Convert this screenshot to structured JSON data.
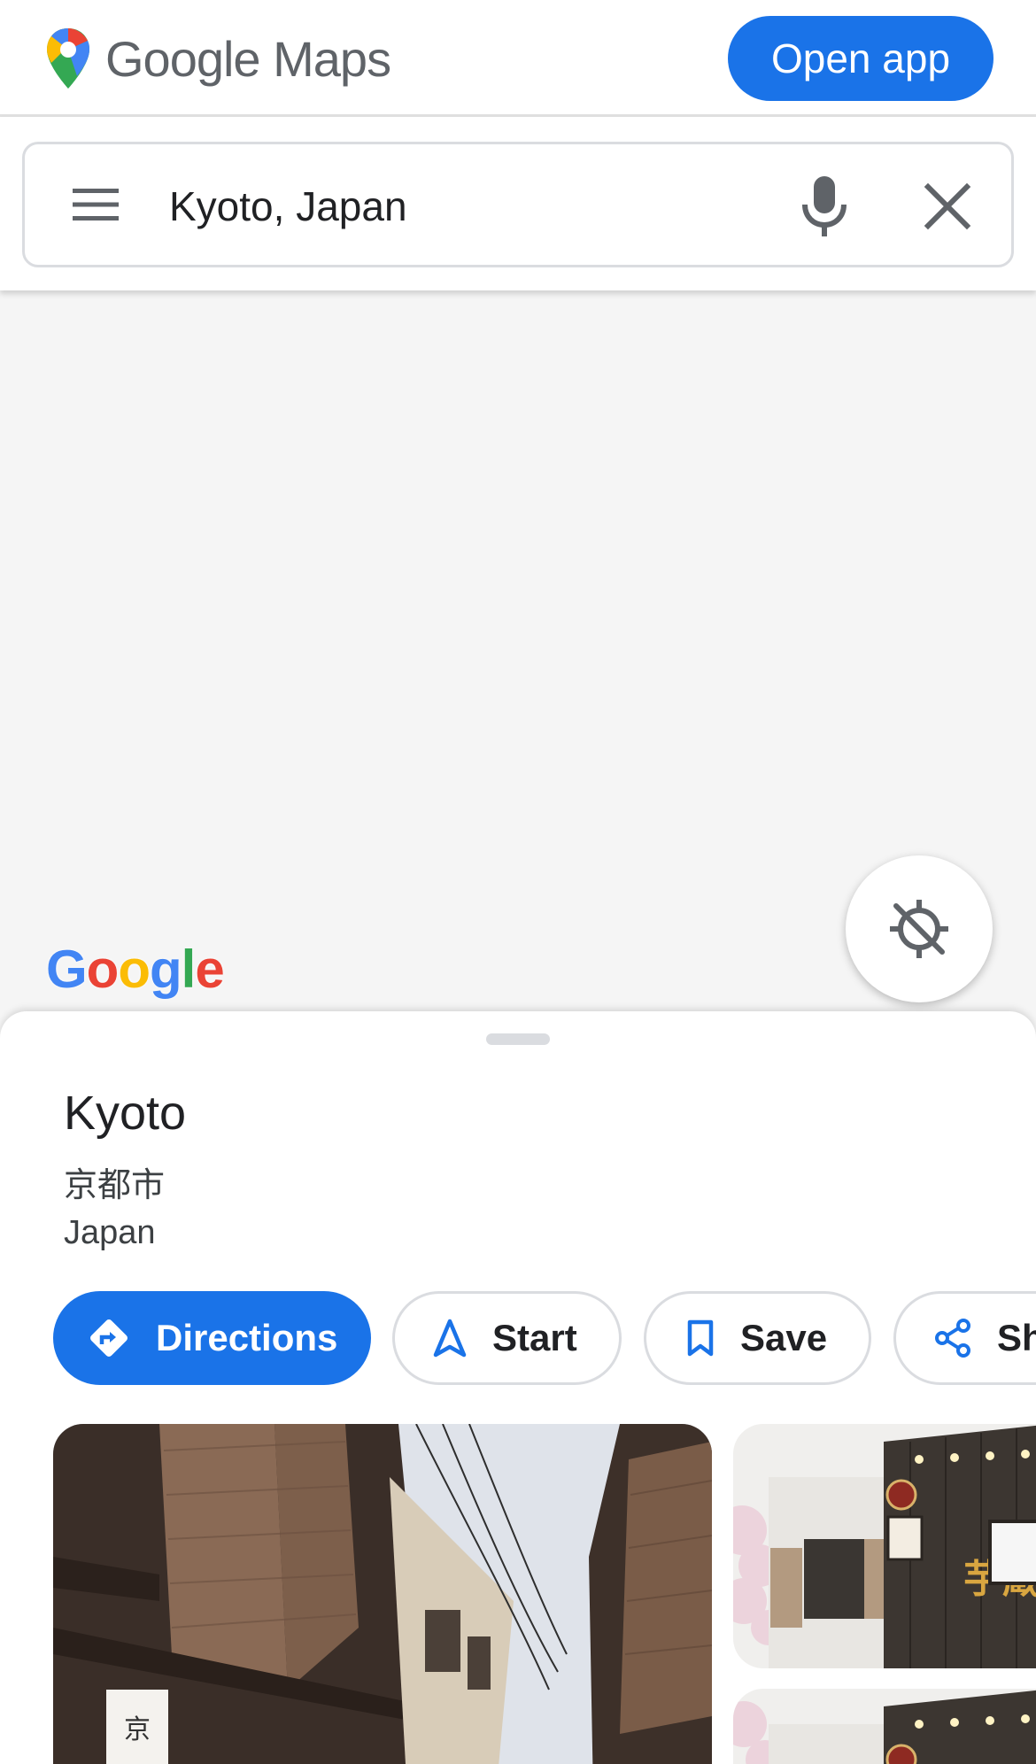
{
  "header": {
    "brand_name": "Google Maps",
    "open_app_label": "Open app",
    "logo_icon": "maps-pin-icon"
  },
  "search": {
    "value": "Kyoto, Japan",
    "menu_icon": "hamburger-menu-icon",
    "mic_icon": "microphone-icon",
    "clear_icon": "close-icon"
  },
  "map": {
    "watermark": "Google",
    "locate_icon": "location-disabled-icon"
  },
  "place": {
    "name": "Kyoto",
    "local_name": "京都市",
    "country": "Japan"
  },
  "actions": [
    {
      "label": "Directions",
      "icon": "directions-icon"
    },
    {
      "label": "Start",
      "icon": "navigation-arrow-icon"
    },
    {
      "label": "Save",
      "icon": "bookmark-icon"
    },
    {
      "label": "Share",
      "icon": "share-icon"
    }
  ],
  "photos": {
    "sign_text_main": "京",
    "sign_text_side": "芋蔵"
  },
  "colors": {
    "accent": "#1a73e8",
    "text_primary": "#202124",
    "text_secondary": "#3c4043",
    "border": "#dadce0",
    "map_background": "#f5f5f5",
    "google_blue": "#4285f4",
    "google_red": "#ea4335",
    "google_yellow": "#fbbc05",
    "google_green": "#34a853"
  }
}
